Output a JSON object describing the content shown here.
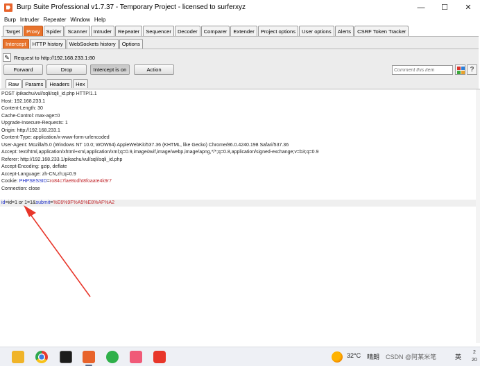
{
  "window": {
    "title": "Burp Suite Professional v1.7.37 - Temporary Project - licensed to surferxyz",
    "minimize": "—",
    "maximize": "☐",
    "close": "✕"
  },
  "menu": [
    "Burp",
    "Intruder",
    "Repeater",
    "Window",
    "Help"
  ],
  "main_tabs": [
    "Target",
    "Proxy",
    "Spider",
    "Scanner",
    "Intruder",
    "Repeater",
    "Sequencer",
    "Decoder",
    "Comparer",
    "Extender",
    "Project options",
    "User options",
    "Alerts",
    "CSRF Token Tracker"
  ],
  "main_tab_active": "Proxy",
  "proxy_tabs": [
    "Intercept",
    "HTTP history",
    "WebSockets history",
    "Options"
  ],
  "proxy_tab_active": "Intercept",
  "request_label": "Request to http://192.168.233.1:80",
  "buttons": {
    "forward": "Forward",
    "drop": "Drop",
    "intercept": "Intercept is on",
    "action": "Action"
  },
  "comment_placeholder": "Comment this item",
  "help_label": "?",
  "editor_tabs": [
    "Raw",
    "Params",
    "Headers",
    "Hex"
  ],
  "editor_tab_active": "Raw",
  "request_lines": [
    "POST /pikachu/vul/sqli/sqli_id.php HTTP/1.1",
    "Host: 192.168.233.1",
    "Content-Length: 30",
    "Cache-Control: max-age=0",
    "Upgrade-Insecure-Requests: 1",
    "Origin: http://192.168.233.1",
    "Content-Type: application/x-www-form-urlencoded",
    "User-Agent: Mozilla/5.0 (Windows NT 10.0; WOW64) AppleWebKit/537.36 (KHTML, like Gecko) Chrome/86.0.4240.198 Safari/537.36",
    "Accept: text/html,application/xhtml+xml,application/xml;q=0.9,image/avif,image/webp,image/apng,*/*;q=0.8,application/signed-exchange;v=b3;q=0.9",
    "Referer: http://192.168.233.1/pikachu/vul/sqli/sqli_id.php",
    "Accept-Encoding: gzip, deflate",
    "Accept-Language: zh-CN,zh;q=0.9"
  ],
  "cookie": {
    "prefix": "Cookie: ",
    "name": "PHPSESSID",
    "eq": "=",
    "value": "ro84c7lae8odht8foaate4k9r7"
  },
  "connection_line": "Connection: close",
  "body": {
    "p1_name": "id",
    "p1_eq": "=",
    "p1_value": "id=1 or 1=1",
    "amp": "&",
    "p2_name": "submit",
    "p2_eq": "=",
    "p2_value": "%E6%9F%A5%E8%AF%A2"
  },
  "taskbar": {
    "temperature": "32°C",
    "weather": "晴朗",
    "watermark": "CSDN @阿某米笔",
    "ime": "英",
    "clock_top": "2",
    "clock_bottom": "20"
  },
  "colors": {
    "accent": "#e8732c",
    "param_blue": "#2030c8",
    "value_red": "#c0262b",
    "arrow_red": "#e8362a"
  }
}
